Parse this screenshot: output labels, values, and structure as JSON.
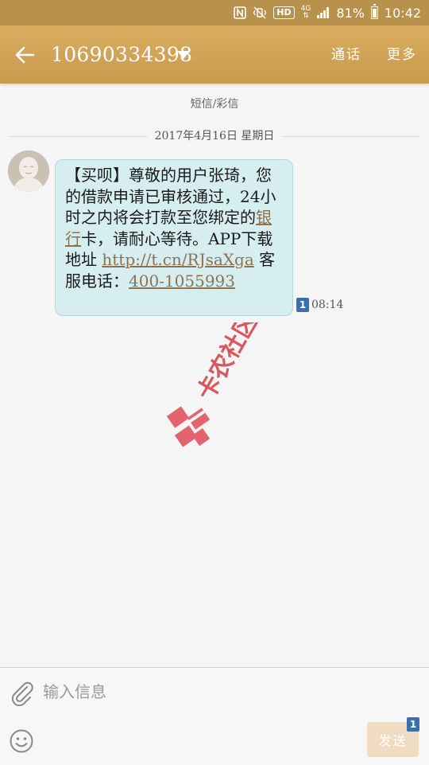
{
  "status_bar": {
    "network_type": "4G",
    "battery_percent": "81%",
    "time": "10:42",
    "hd_label": "HD",
    "icons": [
      "nfc-icon",
      "vibrate-mute-icon",
      "hd-voice-icon",
      "lte-icon",
      "signal-icon",
      "battery-icon"
    ]
  },
  "header": {
    "contact_number": "10690334398",
    "call_label": "通话",
    "more_label": "更多",
    "background": "#c99a4e"
  },
  "conversation": {
    "message_type_label": "短信/彩信",
    "date_label": "2017年4月16日 星期日",
    "messages": [
      {
        "text_before_link1": "【买呗】尊敬的用户张琦，您的借款申请已审核通过，24小时之内将会打款至您绑定的",
        "link1": "银行",
        "text_between": "卡，请耐心等待。APP下载地址 ",
        "link2": "http://t.cn/RJsaXga",
        "text_after_link2": " 客服电话：",
        "link3": "400-1055993",
        "sim_slot": "1",
        "time": "08:14",
        "bubble_color": "#d7eef0"
      }
    ]
  },
  "watermark": {
    "text": "卡农社区"
  },
  "input_area": {
    "placeholder": "输入信息",
    "send_label": "发送",
    "send_sim_slot": "1",
    "send_button_color": "#efdcc1"
  }
}
